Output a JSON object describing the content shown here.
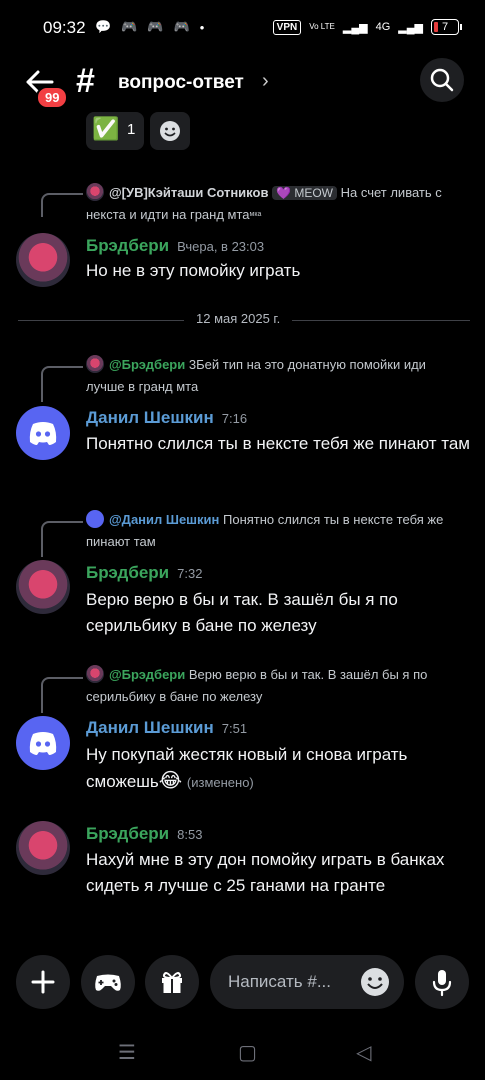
{
  "status": {
    "time": "09:32",
    "vpn": "VPN",
    "volte": "Vo LTE",
    "net": "4G",
    "battery": "7"
  },
  "header": {
    "badge": "99",
    "channel_name": "вопрос-ответ"
  },
  "reaction": {
    "emoji": "✅",
    "count": "1"
  },
  "messages": [
    {
      "reply": {
        "author": "@[УВ]Кэйташи Сотников",
        "tag": "💜 MEOW",
        "text": "На счет ливать с некста и идти на гранд мта",
        "suffix": "мка"
      },
      "author": "Брэдбери",
      "time": "Вчера, в 23:03",
      "text": "Но не в эту помойку играть"
    },
    {
      "reply": {
        "author": "@Брэдбери",
        "text": "3Бей  тип на это донатную помойки иди лучше в гранд мта"
      },
      "author": "Данил Шешкин",
      "time": "7:16",
      "text": "Понятно слился ты в нексте тебя же пинают там"
    },
    {
      "reply": {
        "author": "@Данил Шешкин",
        "text": "Понятно слился ты в нексте тебя же пинают там"
      },
      "author": "Брэдбери",
      "time": "7:32",
      "text": "Верю верю в бы и так. В зашёл бы я по серильбику в бане по железу"
    },
    {
      "reply": {
        "author": "@Брэдбери",
        "text": "Верю верю в бы и так. В зашёл бы я по серильбику в бане по железу"
      },
      "author": "Данил Шешкин",
      "time": "7:51",
      "text": "Ну покупай жестяк новый и снова играть сможешь",
      "emoji": "😂",
      "edited": "(изменено)"
    },
    {
      "author": "Брэдбери",
      "time": "8:53",
      "text": "Нахуй мне в эту дон помойку играть в банках сидеть я лучше с 25 ганами на гранте"
    }
  ],
  "date_divider": "12 мая 2025 г.",
  "composer": {
    "placeholder": "Написать #..."
  },
  "icons": [
    "back-arrow-icon",
    "hash-icon",
    "search-icon",
    "plus-icon",
    "gamepad-icon",
    "gift-icon",
    "emoji-icon",
    "mic-icon",
    "discord-icon"
  ],
  "colors": {
    "accent": "#5865f2",
    "green_author": "#3ba55d",
    "blue_author": "#5b9bd5",
    "badge": "#f23f43"
  }
}
